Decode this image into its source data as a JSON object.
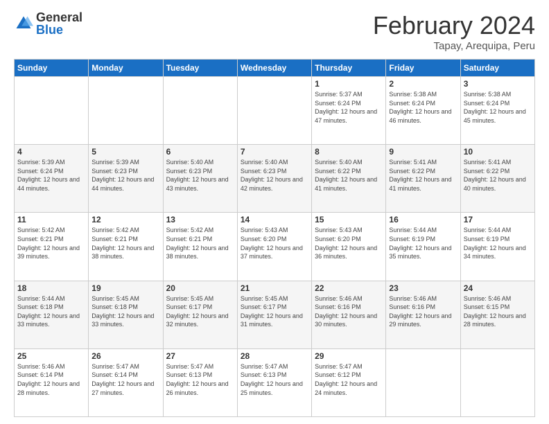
{
  "logo": {
    "general": "General",
    "blue": "Blue"
  },
  "title": "February 2024",
  "subtitle": "Tapay, Arequipa, Peru",
  "days": [
    "Sunday",
    "Monday",
    "Tuesday",
    "Wednesday",
    "Thursday",
    "Friday",
    "Saturday"
  ],
  "weeks": [
    [
      {
        "day": "",
        "info": ""
      },
      {
        "day": "",
        "info": ""
      },
      {
        "day": "",
        "info": ""
      },
      {
        "day": "",
        "info": ""
      },
      {
        "day": "1",
        "info": "Sunrise: 5:37 AM\nSunset: 6:24 PM\nDaylight: 12 hours and 47 minutes."
      },
      {
        "day": "2",
        "info": "Sunrise: 5:38 AM\nSunset: 6:24 PM\nDaylight: 12 hours and 46 minutes."
      },
      {
        "day": "3",
        "info": "Sunrise: 5:38 AM\nSunset: 6:24 PM\nDaylight: 12 hours and 45 minutes."
      }
    ],
    [
      {
        "day": "4",
        "info": "Sunrise: 5:39 AM\nSunset: 6:24 PM\nDaylight: 12 hours and 44 minutes."
      },
      {
        "day": "5",
        "info": "Sunrise: 5:39 AM\nSunset: 6:23 PM\nDaylight: 12 hours and 44 minutes."
      },
      {
        "day": "6",
        "info": "Sunrise: 5:40 AM\nSunset: 6:23 PM\nDaylight: 12 hours and 43 minutes."
      },
      {
        "day": "7",
        "info": "Sunrise: 5:40 AM\nSunset: 6:23 PM\nDaylight: 12 hours and 42 minutes."
      },
      {
        "day": "8",
        "info": "Sunrise: 5:40 AM\nSunset: 6:22 PM\nDaylight: 12 hours and 41 minutes."
      },
      {
        "day": "9",
        "info": "Sunrise: 5:41 AM\nSunset: 6:22 PM\nDaylight: 12 hours and 41 minutes."
      },
      {
        "day": "10",
        "info": "Sunrise: 5:41 AM\nSunset: 6:22 PM\nDaylight: 12 hours and 40 minutes."
      }
    ],
    [
      {
        "day": "11",
        "info": "Sunrise: 5:42 AM\nSunset: 6:21 PM\nDaylight: 12 hours and 39 minutes."
      },
      {
        "day": "12",
        "info": "Sunrise: 5:42 AM\nSunset: 6:21 PM\nDaylight: 12 hours and 38 minutes."
      },
      {
        "day": "13",
        "info": "Sunrise: 5:42 AM\nSunset: 6:21 PM\nDaylight: 12 hours and 38 minutes."
      },
      {
        "day": "14",
        "info": "Sunrise: 5:43 AM\nSunset: 6:20 PM\nDaylight: 12 hours and 37 minutes."
      },
      {
        "day": "15",
        "info": "Sunrise: 5:43 AM\nSunset: 6:20 PM\nDaylight: 12 hours and 36 minutes."
      },
      {
        "day": "16",
        "info": "Sunrise: 5:44 AM\nSunset: 6:19 PM\nDaylight: 12 hours and 35 minutes."
      },
      {
        "day": "17",
        "info": "Sunrise: 5:44 AM\nSunset: 6:19 PM\nDaylight: 12 hours and 34 minutes."
      }
    ],
    [
      {
        "day": "18",
        "info": "Sunrise: 5:44 AM\nSunset: 6:18 PM\nDaylight: 12 hours and 33 minutes."
      },
      {
        "day": "19",
        "info": "Sunrise: 5:45 AM\nSunset: 6:18 PM\nDaylight: 12 hours and 33 minutes."
      },
      {
        "day": "20",
        "info": "Sunrise: 5:45 AM\nSunset: 6:17 PM\nDaylight: 12 hours and 32 minutes."
      },
      {
        "day": "21",
        "info": "Sunrise: 5:45 AM\nSunset: 6:17 PM\nDaylight: 12 hours and 31 minutes."
      },
      {
        "day": "22",
        "info": "Sunrise: 5:46 AM\nSunset: 6:16 PM\nDaylight: 12 hours and 30 minutes."
      },
      {
        "day": "23",
        "info": "Sunrise: 5:46 AM\nSunset: 6:16 PM\nDaylight: 12 hours and 29 minutes."
      },
      {
        "day": "24",
        "info": "Sunrise: 5:46 AM\nSunset: 6:15 PM\nDaylight: 12 hours and 28 minutes."
      }
    ],
    [
      {
        "day": "25",
        "info": "Sunrise: 5:46 AM\nSunset: 6:14 PM\nDaylight: 12 hours and 28 minutes."
      },
      {
        "day": "26",
        "info": "Sunrise: 5:47 AM\nSunset: 6:14 PM\nDaylight: 12 hours and 27 minutes."
      },
      {
        "day": "27",
        "info": "Sunrise: 5:47 AM\nSunset: 6:13 PM\nDaylight: 12 hours and 26 minutes."
      },
      {
        "day": "28",
        "info": "Sunrise: 5:47 AM\nSunset: 6:13 PM\nDaylight: 12 hours and 25 minutes."
      },
      {
        "day": "29",
        "info": "Sunrise: 5:47 AM\nSunset: 6:12 PM\nDaylight: 12 hours and 24 minutes."
      },
      {
        "day": "",
        "info": ""
      },
      {
        "day": "",
        "info": ""
      }
    ]
  ]
}
